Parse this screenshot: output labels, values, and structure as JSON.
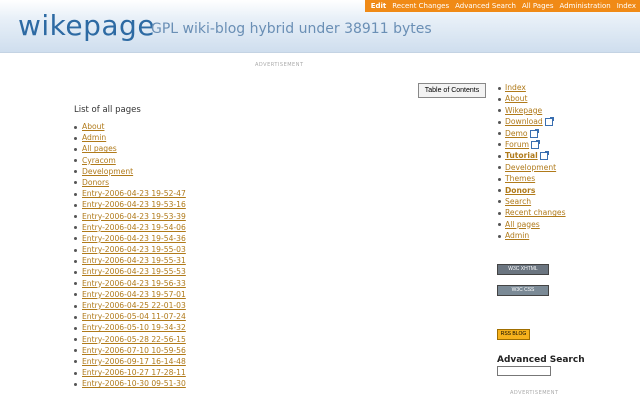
{
  "topnav": {
    "items": [
      "Edit",
      "Recent Changes",
      "Advanced Search",
      "All Pages",
      "Administration",
      "Index"
    ]
  },
  "site": {
    "title": "wikepage",
    "subtitle": "GPL wiki-blog hybrid under 38911 bytes"
  },
  "ads": {
    "top_label": "ADVERTISEMENT",
    "bottom_label": "ADVERTISEMENT"
  },
  "main": {
    "toc_button": "Table of Contents",
    "heading": "List of all pages",
    "pages": [
      "About",
      "Admin",
      "All  pages",
      "Cyracom",
      "Development",
      "Donors",
      "Entry-2006-04-23  19-52-47",
      "Entry-2006-04-23  19-53-16",
      "Entry-2006-04-23  19-53-39",
      "Entry-2006-04-23  19-54-06",
      "Entry-2006-04-23  19-54-36",
      "Entry-2006-04-23  19-55-03",
      "Entry-2006-04-23  19-55-31",
      "Entry-2006-04-23  19-55-53",
      "Entry-2006-04-23  19-56-33",
      "Entry-2006-04-23  19-57-01",
      "Entry-2006-04-25  22-01-03",
      "Entry-2006-05-04  11-07-24",
      "Entry-2006-05-10  19-34-32",
      "Entry-2006-05-28  22-56-15",
      "Entry-2006-07-10  10-59-56",
      "Entry-2006-09-17  16-14-48",
      "Entry-2006-10-27  17-28-11",
      "Entry-2006-10-30  09-51-30"
    ]
  },
  "sidebar": {
    "items": [
      {
        "label": "Index",
        "bold": false,
        "external": false
      },
      {
        "label": "About",
        "bold": false,
        "external": false
      },
      {
        "label": "Wikepage",
        "bold": false,
        "external": false
      },
      {
        "label": "Download",
        "bold": false,
        "external": true
      },
      {
        "label": "Demo",
        "bold": false,
        "external": true
      },
      {
        "label": "Forum",
        "bold": false,
        "external": true
      },
      {
        "label": "Tutorial",
        "bold": true,
        "external": true
      },
      {
        "label": "Development",
        "bold": false,
        "external": false
      },
      {
        "label": "Themes",
        "bold": false,
        "external": false
      },
      {
        "label": "Donors",
        "bold": true,
        "external": false
      },
      {
        "label": "Search",
        "bold": false,
        "external": false
      },
      {
        "label": "Recent  changes",
        "bold": false,
        "external": false
      },
      {
        "label": "All  pages",
        "bold": false,
        "external": false
      },
      {
        "label": "Admin",
        "bold": false,
        "external": false
      }
    ],
    "badges": [
      "W3C XHTML",
      "W3C CSS",
      "RSS BLOG"
    ],
    "advanced_search_label": "Advanced  Search"
  }
}
